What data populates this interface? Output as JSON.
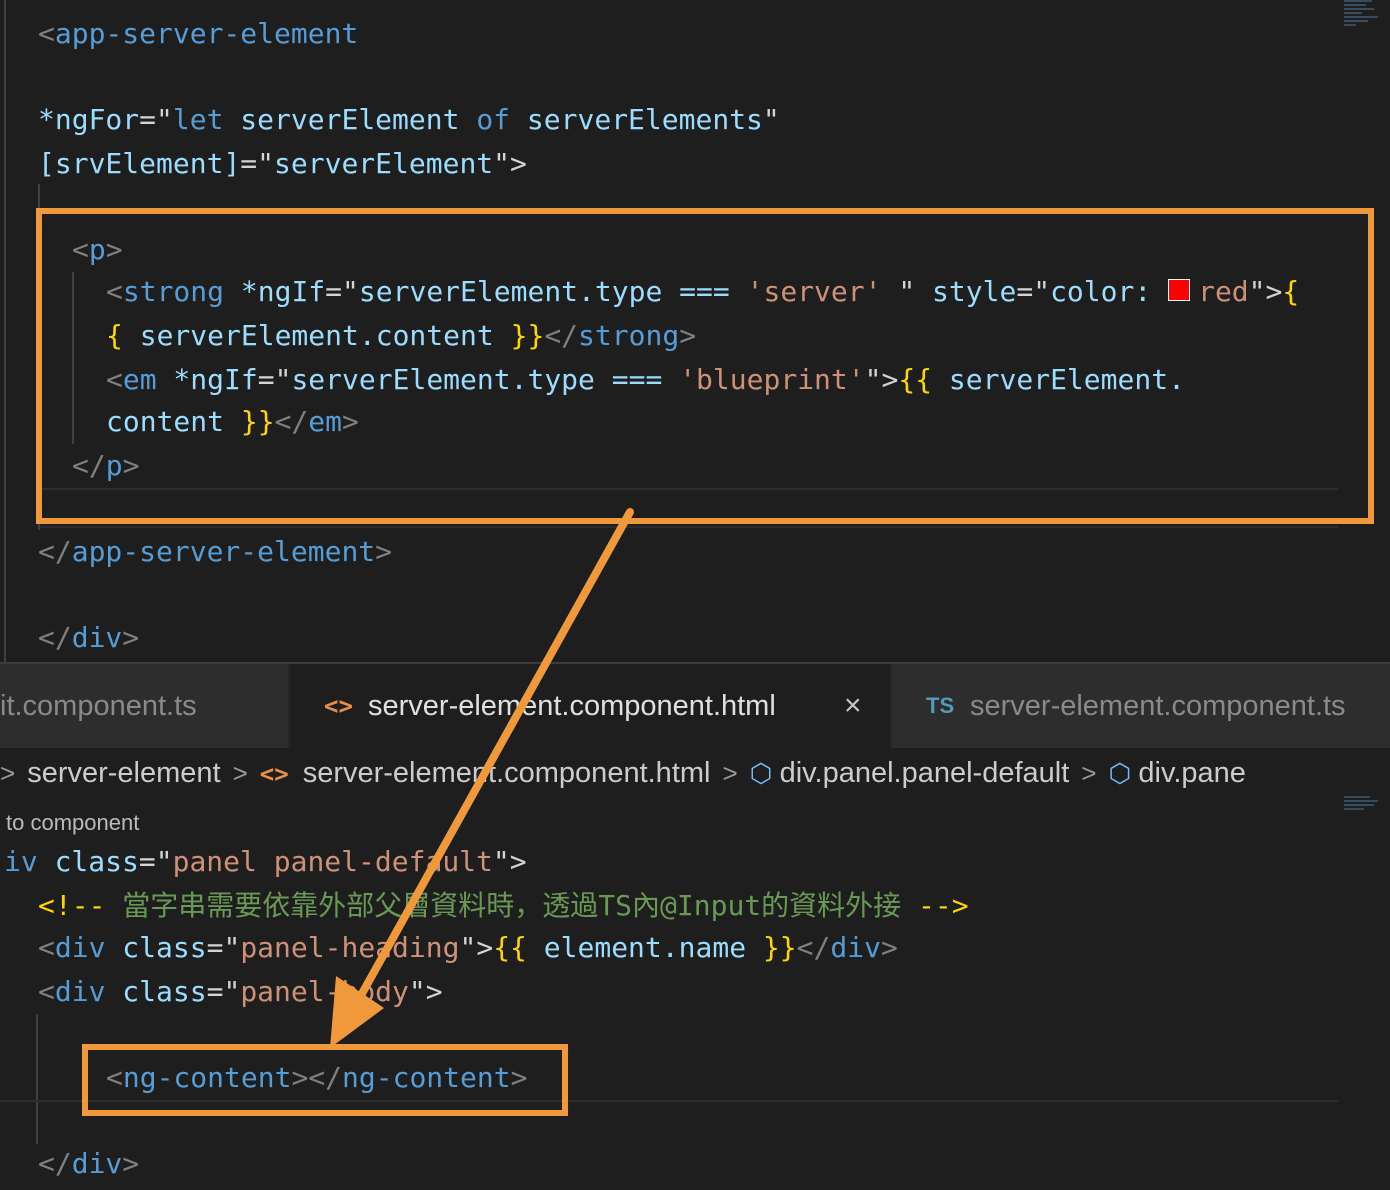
{
  "top_editor": {
    "line_app_open": {
      "bracket_open": "<",
      "tag": "app-server-element"
    },
    "line_ngfor": {
      "attr": "*ngFor",
      "eq_quote": "=\"",
      "kw_let": "let",
      "var": " serverElement ",
      "kw_of": "of",
      "list": " serverElements",
      "close_quote": "\""
    },
    "line_srvelement": {
      "bracket_l": "[",
      "attr": "srvElement",
      "bracket_r": "]",
      "eq_quote": "=\"",
      "value": "serverElement",
      "close": "\">"
    },
    "line_p_open": {
      "bracket_open": "<",
      "tag": "p",
      "bracket_close": ">"
    },
    "line_strong": {
      "bracket_open": "<",
      "tag": "strong",
      "attr_ngif": " *ngIf",
      "eq_quote": "=\"",
      "expr_a": "serverElement.type === ",
      "literal": "'server'",
      "expr_b": " ",
      "close_quote": "\"",
      "attr_style": " style",
      "style_eq": "=\"",
      "style_prop": "color: ",
      "style_value": "red",
      "close_tag": "\">",
      "interp_open": "{"
    },
    "line_strong_cont": {
      "interp_open": "{",
      "text": " serverElement.content ",
      "interp_close": "}}",
      "close_bracket": "</",
      "tag": "strong",
      "bracket_close": ">"
    },
    "line_em": {
      "bracket_open": "<",
      "tag": "em",
      "attr_ngif": " *ngIf",
      "eq_quote": "=\"",
      "expr_a": "serverElement.type === ",
      "literal": "'blueprint'",
      "close_quote": "\"",
      "close_tag": ">",
      "interp_open": "{{",
      "text": " serverElement."
    },
    "line_em_cont": {
      "text": "content ",
      "interp_close": "}}",
      "close_bracket": "</",
      "tag": "em",
      "bracket_close": ">"
    },
    "line_p_close": {
      "bracket_open": "</",
      "tag": "p",
      "bracket_close": ">"
    },
    "line_app_close": {
      "bracket_open": "</",
      "tag": "app-server-element",
      "bracket_close": ">"
    },
    "line_div_close": {
      "bracket_open": "</",
      "tag": "div",
      "bracket_close": ">"
    }
  },
  "tabs": [
    {
      "label": "it.component.ts",
      "icon": "",
      "active": false
    },
    {
      "label": "server-element.component.html",
      "icon": "<>",
      "active": true,
      "close": "×"
    },
    {
      "label": "server-element.component.ts",
      "icon": "TS",
      "active": false
    }
  ],
  "breadcrumb": {
    "sep": ">",
    "items": [
      "server-element",
      "server-element.component.html",
      "div.panel.panel-default",
      "div.pane"
    ],
    "file_icon": "<>"
  },
  "code_hint": "to component",
  "bottom_editor": {
    "line_div": {
      "tag_part": "iv",
      "attr": " class",
      "eq_quote": "=\"",
      "value": "panel panel-default",
      "close": "\">"
    },
    "line_comment": {
      "open": "<!--",
      "text": " 當字串需要依靠外部父層資料時，透過TS內@Input的資料外接 ",
      "close": "-->"
    },
    "line_heading": {
      "bracket_open": "<",
      "tag": "div",
      "attr": " class",
      "eq_quote": "=\"",
      "value": "panel-heading",
      "close": "\">",
      "interp_open": "{{",
      "text": " element.name ",
      "interp_close": "}}",
      "close_bracket": "</",
      "close_tag": "div",
      "bracket_close": ">"
    },
    "line_body": {
      "bracket_open": "<",
      "tag": "div",
      "attr": " class",
      "eq_quote": "=\"",
      "value": "panel-body",
      "close": "\">"
    },
    "line_ngcontent": {
      "bracket_open": "<",
      "tag": "ng-content",
      "mid": "></",
      "close_tag": "ng-content",
      "bracket_close": ">"
    },
    "line_div_close": {
      "bracket_open": "</",
      "tag": "div",
      "bracket_close": ">"
    }
  },
  "colors": {
    "annotation": "#f0993a",
    "tag": "#569cd6",
    "attribute": "#9cdcfe",
    "string": "#ce9178",
    "comment": "#6a9955",
    "interpolation": "#ffd700",
    "color_swatch": "#ff0000"
  }
}
